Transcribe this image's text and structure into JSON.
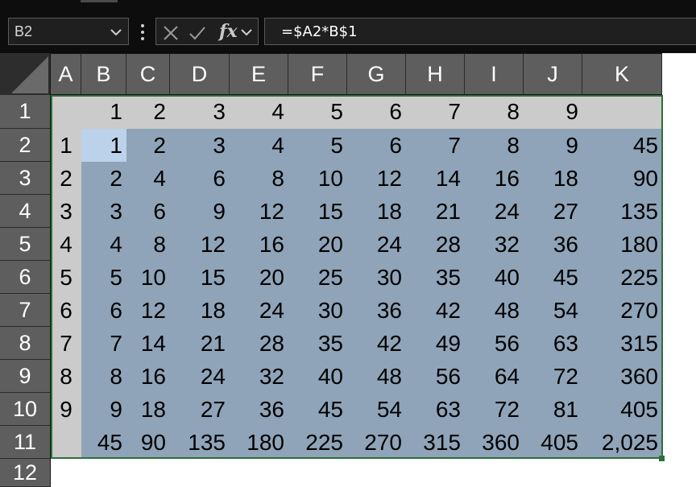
{
  "name_box": {
    "value": "B2"
  },
  "formula_bar": {
    "value": "=$A2*B$1",
    "fx_label": "fx"
  },
  "columns": [
    "A",
    "B",
    "C",
    "D",
    "E",
    "F",
    "G",
    "H",
    "I",
    "J",
    "K"
  ],
  "rows": [
    "1",
    "2",
    "3",
    "4",
    "5",
    "6",
    "7",
    "8",
    "9",
    "10",
    "11",
    "12"
  ],
  "cells": [
    [
      "",
      "1",
      "2",
      "3",
      "4",
      "5",
      "6",
      "7",
      "8",
      "9",
      ""
    ],
    [
      "1",
      "1",
      "2",
      "3",
      "4",
      "5",
      "6",
      "7",
      "8",
      "9",
      "45"
    ],
    [
      "2",
      "2",
      "4",
      "6",
      "8",
      "10",
      "12",
      "14",
      "16",
      "18",
      "90"
    ],
    [
      "3",
      "3",
      "6",
      "9",
      "12",
      "15",
      "18",
      "21",
      "24",
      "27",
      "135"
    ],
    [
      "4",
      "4",
      "8",
      "12",
      "16",
      "20",
      "24",
      "28",
      "32",
      "36",
      "180"
    ],
    [
      "5",
      "5",
      "10",
      "15",
      "20",
      "25",
      "30",
      "35",
      "40",
      "45",
      "225"
    ],
    [
      "6",
      "6",
      "12",
      "18",
      "24",
      "30",
      "36",
      "42",
      "48",
      "54",
      "270"
    ],
    [
      "7",
      "7",
      "14",
      "21",
      "28",
      "35",
      "42",
      "49",
      "56",
      "63",
      "315"
    ],
    [
      "8",
      "8",
      "16",
      "24",
      "32",
      "40",
      "48",
      "56",
      "64",
      "72",
      "360"
    ],
    [
      "9",
      "9",
      "18",
      "27",
      "36",
      "45",
      "54",
      "63",
      "72",
      "81",
      "405"
    ],
    [
      "",
      "45",
      "90",
      "135",
      "180",
      "225",
      "270",
      "315",
      "360",
      "405",
      "2,025"
    ],
    [
      "",
      "",
      "",
      "",
      "",
      "",
      "",
      "",
      "",
      "",
      ""
    ]
  ],
  "colors": {
    "header_bg": "#5e5e5e",
    "row1_fill": "#cbcbcb",
    "body_fill": "#8fa4b8",
    "active_cell": "#bcd2ea",
    "selection_border": "#2c6e3c"
  },
  "icons": {
    "name_box_dropdown": "chevron-down-icon",
    "options": "vertical-dots-icon",
    "cancel": "close-icon",
    "enter": "check-icon",
    "insert_function": "fx-icon",
    "expand_formula": "chevron-down-icon"
  }
}
